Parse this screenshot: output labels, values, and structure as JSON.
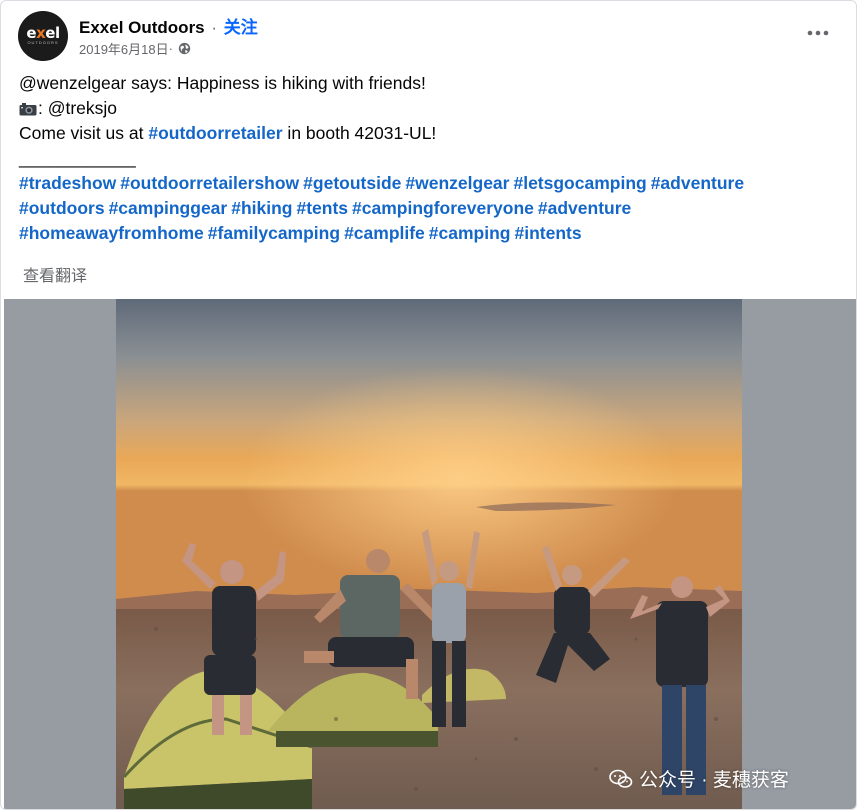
{
  "header": {
    "page_name": "Exxel Outdoors",
    "separator": "·",
    "follow_label": "关注",
    "date": "2019年6月18日",
    "date_dot": " · ",
    "avatar": {
      "logo_text_1": "e",
      "logo_text_2": "x",
      "logo_text_3": "el",
      "logo_sub": "OUTDOORS"
    }
  },
  "post": {
    "line1": "@wenzelgear says: Happiness is hiking with friends!",
    "line2_icon": "camera-icon",
    "line2_text": ": @treksjo",
    "line3_prefix": "Come visit us at ",
    "line3_link": "#outdoorretailer",
    "line3_suffix": " in booth 42031-UL!",
    "divider": "____________",
    "hashtags_line1": [
      "#tradeshow",
      "#outdoorretailershow",
      "#getoutside",
      "#wenzelgear",
      "#letsgocamping",
      "#adventure"
    ],
    "hashtags_line2": [
      "#outdoors",
      "#campinggear",
      "#hiking",
      "#tents",
      "#campingforeveryone",
      "#adventure"
    ],
    "hashtags_line3": [
      "#homeawayfromhome",
      "#familycamping",
      "#camplife",
      "#camping",
      "#intents"
    ],
    "translate_label": "查看翻译"
  },
  "watermark": {
    "text": "公众号 · 麦穗获客",
    "icon": "wechat-icon"
  },
  "colors": {
    "link": "#1467c8",
    "follow": "#0866ff",
    "secondary_text": "#65676b",
    "photo_letterbox": "#979ca3"
  }
}
